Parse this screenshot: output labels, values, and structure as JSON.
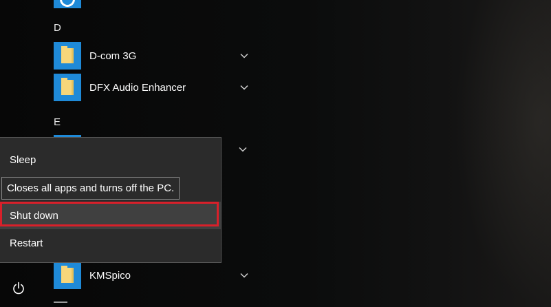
{
  "start_menu": {
    "groups": [
      {
        "letter": "D",
        "apps": [
          {
            "label": "D-com 3G",
            "icon": "folder-icon"
          },
          {
            "label": "DFX Audio Enhancer",
            "icon": "folder-icon"
          }
        ]
      },
      {
        "letter": "E",
        "apps": []
      }
    ],
    "below_menu_app": {
      "label": "KMSpico",
      "icon": "folder-icon"
    }
  },
  "power_menu": {
    "items": [
      {
        "label": "Sleep"
      },
      {
        "label": "Shut down",
        "highlighted": true
      },
      {
        "label": "Restart"
      }
    ],
    "tooltip": "Closes all apps and turns off the PC."
  },
  "colors": {
    "tile_blue": "#1f8ad8",
    "folder_yellow": "#f6d67a",
    "highlight_red": "#d9202a",
    "menu_bg": "#2b2b2b"
  },
  "icons": {
    "power_button": "power-icon",
    "expand": "chevron-down-icon"
  }
}
